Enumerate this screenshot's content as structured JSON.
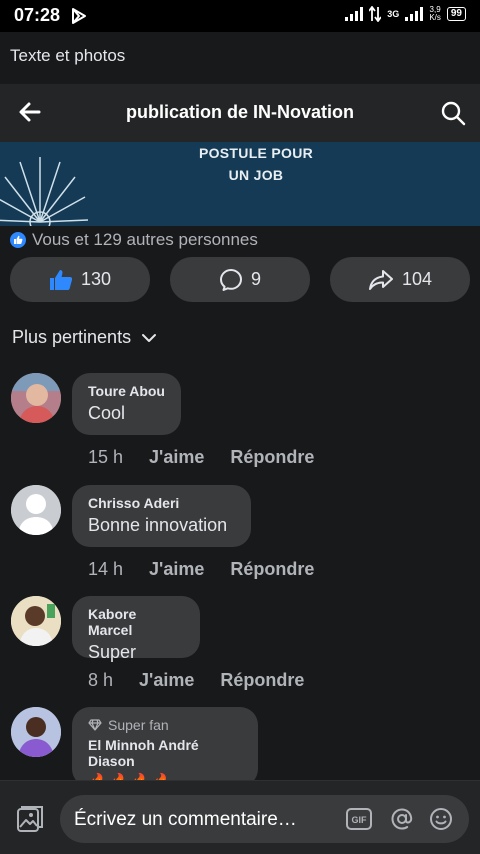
{
  "status": {
    "time": "07:28",
    "network": "3G",
    "speed_top": "3,9",
    "speed_bottom": "K/s",
    "battery": "99"
  },
  "prev_text": "Texte et photos",
  "header": {
    "title": "publication de IN-Novation",
    "back_icon": "back-arrow-icon",
    "search_icon": "search-icon"
  },
  "banner": {
    "line1": "POSTULE POUR",
    "line2": "UN JOB"
  },
  "reactions": {
    "summary": "Vous et 129 autres personnes"
  },
  "actions": {
    "like_count": "130",
    "comment_count": "9",
    "share_count": "104"
  },
  "sort": {
    "label": "Plus pertinents"
  },
  "comments": [
    {
      "name": "Toure Abou",
      "text": "Cool",
      "time": "15 h",
      "like": "J'aime",
      "reply": "Répondre"
    },
    {
      "name": "Chrisso Aderi",
      "text": "Bonne innovation",
      "time": "14 h",
      "like": "J'aime",
      "reply": "Répondre"
    },
    {
      "name": "Kabore Marcel",
      "text": "Super",
      "time": "8 h",
      "like": "J'aime",
      "reply": "Répondre"
    },
    {
      "badge": "Super fan",
      "name": "El Minnoh André Diason",
      "text": "🔥🔥🔥🔥"
    }
  ],
  "composer": {
    "placeholder": "Écrivez un commentaire…",
    "gif": "GIF"
  },
  "colors": {
    "accent": "#2e89ff",
    "background": "#18191a",
    "bubble": "#3a3b3c",
    "banner": "#143a55"
  }
}
